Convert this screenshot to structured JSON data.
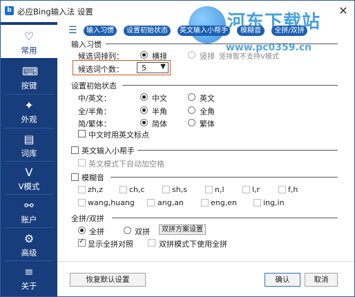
{
  "window": {
    "title": "必应Bing输入法 设置",
    "app_icon": "b",
    "close": "✕"
  },
  "watermark": {
    "text": "河东下载站",
    "url": "www.pc0359.cn"
  },
  "sidebar": {
    "items": [
      {
        "label": "常用",
        "icon": "♡",
        "icon_name": "heart-icon",
        "active": true
      },
      {
        "label": "按键",
        "icon": "⌨",
        "icon_name": "keyboard-icon",
        "active": false
      },
      {
        "label": "外观",
        "icon": "✦",
        "icon_name": "magic-wand-icon",
        "active": false
      },
      {
        "label": "词库",
        "icon": "▤",
        "icon_name": "book-icon",
        "active": false
      },
      {
        "label": "V模式",
        "icon": "V",
        "icon_name": "v-mode-icon",
        "active": false
      },
      {
        "label": "账户",
        "icon": "⚯",
        "icon_name": "account-icon",
        "active": false
      },
      {
        "label": "高级",
        "icon": "⚙",
        "icon_name": "gear-icon",
        "active": false
      },
      {
        "label": "关于",
        "icon": "≡",
        "icon_name": "about-icon",
        "active": false
      }
    ]
  },
  "topnav": {
    "menu_icon": "☰",
    "tabs": [
      "输入习惯",
      "设置初始状态",
      "英文输入小帮手",
      "模糊音",
      "全拼/双拼"
    ]
  },
  "input_habit": {
    "title": "输入习惯",
    "candidate_order_label": "候选词排列：",
    "horizontal": "横排",
    "vertical": "竖排",
    "vertical_note": "竖排暂不支持V模式",
    "count_label": "候选词个数：",
    "count_value": "5"
  },
  "initial_state": {
    "title": "设置初始状态",
    "rows": [
      {
        "label": "中/英文：",
        "opt1": "中文",
        "opt2": "英文"
      },
      {
        "label": "全/半角：",
        "opt1": "半角",
        "opt2": "全角"
      },
      {
        "label": "简/繁体：",
        "opt1": "简体",
        "opt2": "繁体"
      }
    ],
    "cn_punct": "中文时用英文标点"
  },
  "english_helper": {
    "title": "英文输入小帮手",
    "auto_space": "英文模式下自动加空格"
  },
  "fuzzy": {
    "title": "模糊音",
    "row1": [
      "zh,z",
      "ch,c",
      "sh,s",
      "n,l",
      "l,r",
      "f,h"
    ],
    "row2": [
      "wang,huang",
      "ang,an",
      "eng,en",
      "ing,in"
    ]
  },
  "pinyin_mode": {
    "title": "全拼/双拼",
    "full": "全拼",
    "double": "双拼",
    "scheme_button": "双拼方案设置",
    "show_full": "显示全拼对照",
    "use_full_in_double": "双拼模式下使用全拼"
  },
  "footer": {
    "restore": "恢复默认设置",
    "ok": "确认",
    "cancel": "取消"
  },
  "colors": {
    "sidebar": "#173d7c",
    "accent": "#1c5fb3",
    "highlight_box": "#d9531e"
  }
}
